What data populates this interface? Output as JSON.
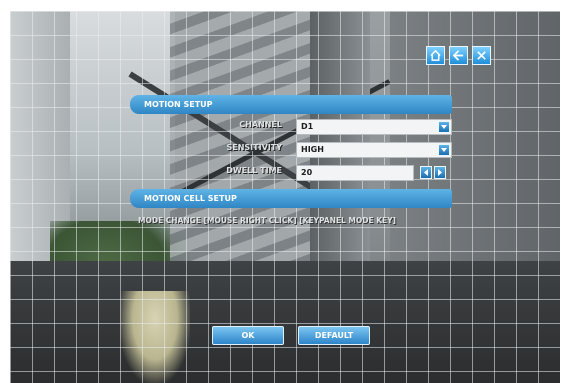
{
  "top_icons": [
    {
      "name": "home-icon"
    },
    {
      "name": "back-arrow-icon"
    },
    {
      "name": "close-icon"
    }
  ],
  "motion_setup": {
    "title": "MOTION SETUP",
    "rows": [
      {
        "label": "CHANNEL",
        "value": "D1"
      },
      {
        "label": "SENSITIVITY",
        "value": "HIGH"
      },
      {
        "label": "DWELL TIME",
        "value": "20"
      }
    ]
  },
  "motion_cell_setup": {
    "title": "MOTION CELL SETUP",
    "hint": "MODE CHANGE [MOUSE RIGHT CLICK] [KEYPANEL MODE KEY]"
  },
  "buttons": {
    "ok": "OK",
    "default": "DEFAULT"
  },
  "colors": {
    "accent": "#2f86c4",
    "bar_light": "#5fb3e6"
  }
}
